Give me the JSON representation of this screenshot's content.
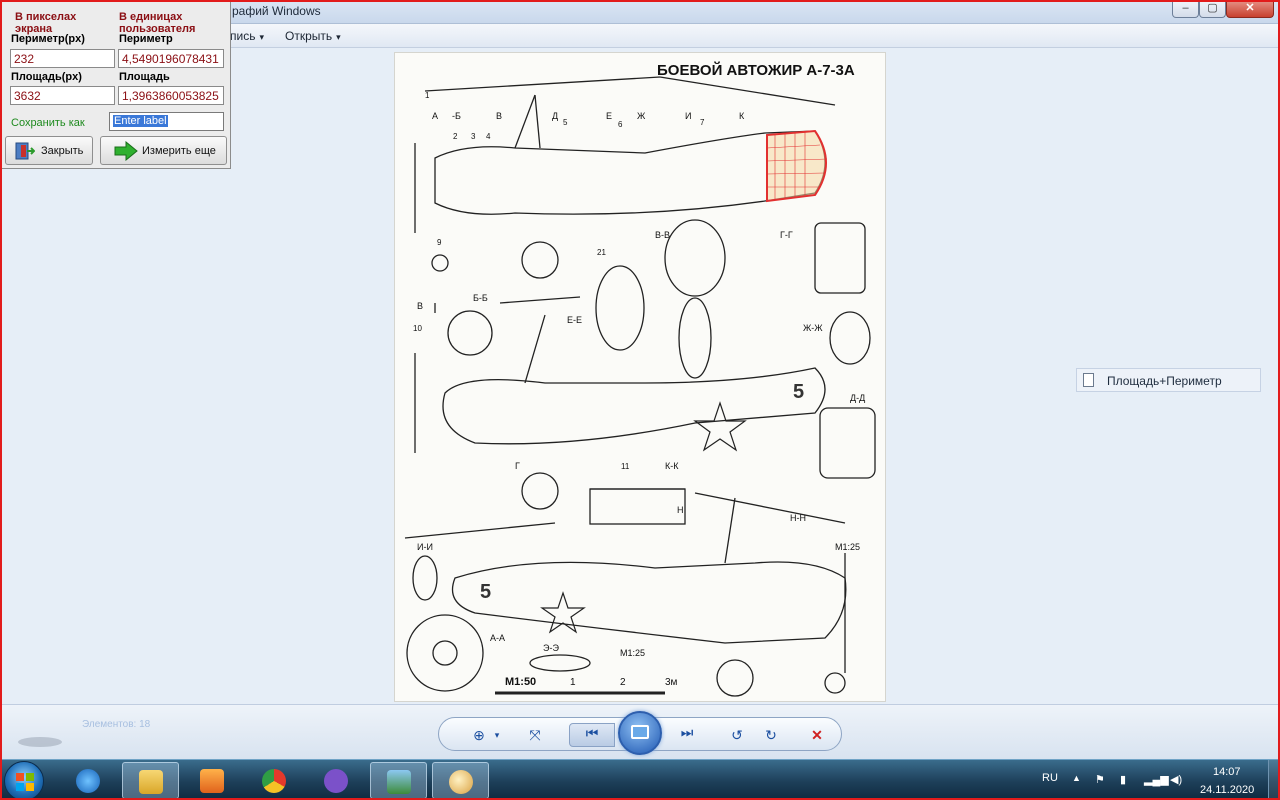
{
  "window": {
    "title": "рафий Windows",
    "min_glyph": "–",
    "max_glyph": "▢",
    "close_glyph": "✕"
  },
  "menu": {
    "record": "пись",
    "open": "Открыть",
    "caret": "▾",
    "help": "?"
  },
  "measure_panel": {
    "header_pixels": "В пикселах экрана",
    "header_user": "В единицах пользователя",
    "perimeter_px_label": "Периметр(px)",
    "perimeter_user_label": "Периметр",
    "perimeter_px_value": "232",
    "perimeter_user_value": "4,5490196078431",
    "area_px_label": "Площадь(px)",
    "area_user_label": "Площадь",
    "area_px_value": "3632",
    "area_user_value": "1,3963860053825",
    "save_as_label": "Сохранить как",
    "label_input_value": "Enter label",
    "close_button": "Закрыть",
    "measure_again_button": "Измерить еще"
  },
  "drawing": {
    "title": "БОЕВОЙ АВТОЖИР А-7-3А",
    "section_labels": [
      "А",
      "-Б",
      "В",
      "Д",
      "Е",
      "Ж",
      "И",
      "К",
      "В-В",
      "Г-Г",
      "Б-Б",
      "Е-Е",
      "Ж-Ж",
      "Д-Д",
      "К-К",
      "Н-Н",
      "И-И",
      "А-А",
      "Э-Э",
      "Н",
      "Г",
      "В"
    ],
    "callouts": [
      "1",
      "2",
      "3",
      "4",
      "5",
      "6",
      "7",
      "9",
      "10",
      "11",
      "21"
    ],
    "scale_text": "М1:50",
    "scale_ticks": [
      "1",
      "2",
      "3м"
    ],
    "ratio_labels": [
      "М1:25",
      "М1:25"
    ],
    "star_number": "5"
  },
  "side_tag": {
    "label": "Площадь+Периметр"
  },
  "control_bar": {
    "faded_caption": "Элементов: 18",
    "zoom_icon": "⊕",
    "fit_icon": "⤧",
    "prev_icon": "⏮",
    "next_icon": "⏭",
    "rotate_ccw_icon": "↺",
    "rotate_cw_icon": "↻",
    "delete_icon": "✕"
  },
  "taskbar": {
    "apps": [
      "internet-explorer",
      "file-explorer",
      "media-player",
      "chrome",
      "viber",
      "photo-viewer",
      "paint"
    ],
    "lang": "RU",
    "time": "14:07",
    "date": "24.11.2020",
    "tray_up": "▲"
  },
  "colors": {
    "frame": "#e21b1b",
    "header_text": "#8b0f14",
    "save_green": "#1e8a1e",
    "taskbar": "#1d3f59",
    "selection_hatch": "#e23030"
  }
}
